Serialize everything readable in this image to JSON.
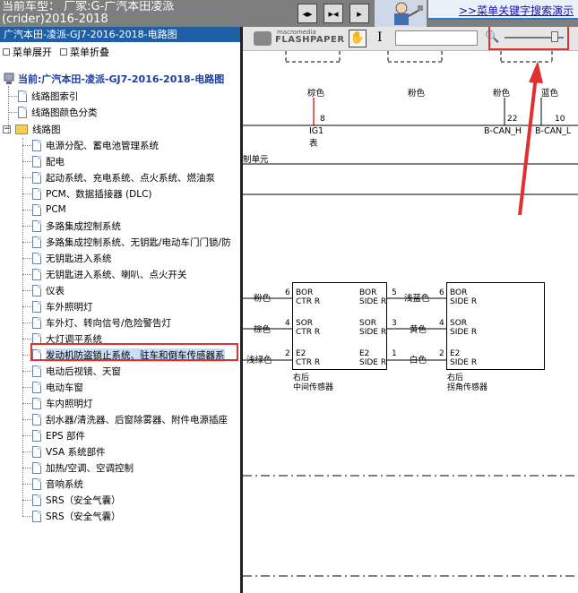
{
  "topbar": {
    "car_title": "当前车型：  厂家:G-广汽本田凌派(crider)2016-2018",
    "btn_fit": "◂▸",
    "btn_expand": "▸◂",
    "btn_more": "▸",
    "search_link": ">>菜单关键字搜索演示"
  },
  "left_panel": {
    "header": "广汽本田-凌派-GJ7-2016-2018-电路图",
    "expand_label": "菜单展开",
    "collapse_label": "菜单折叠",
    "root_label": "当前:广汽本田-凌派-GJ7-2016-2018-电路图",
    "top_items": [
      "线路图索引",
      "线路图颜色分类"
    ],
    "folder_label": "线路图",
    "items": [
      "电源分配、蓄电池管理系统",
      "配电",
      "起动系统、充电系统、点火系统、燃油泵",
      "PCM、数据插接器 (DLC)",
      "PCM",
      "多路集成控制系统",
      "多路集成控制系统、无钥匙/电动车门门锁/防",
      "无钥匙进入系统",
      "无钥匙进入系统、喇叭、点火开关",
      "仪表",
      "车外照明灯",
      "车外灯、转向信号/危险警告灯",
      "大灯调平系统",
      "发动机防盗锁止系统、驻车和倒车传感器系",
      "电动后视镜、天窗",
      "电动车窗",
      "车内照明灯",
      "刮水器/清洗器、后窗除雾器、附件电源插座",
      "EPS 部件",
      "VSA 系统部件",
      "加热/空调、空调控制",
      "音响系统",
      "SRS（安全气囊）",
      "SRS（安全气囊）"
    ],
    "selected_index": 13
  },
  "viewer": {
    "logo_small": "macromedia",
    "logo": "FLASHPAPER",
    "hand": "✋",
    "ibeam": "I",
    "zoom_icon": "🔍",
    "zoom_level": 0.85
  },
  "diagram": {
    "top_wires": [
      {
        "color": "棕色",
        "pin": "8",
        "name": "IG1",
        "sub": "表"
      },
      {
        "color": "粉色"
      },
      {
        "color": "粉色",
        "pin": "22",
        "name": "B-CAN_H"
      },
      {
        "color": "蓝色",
        "pin": "10",
        "name": "B-CAN_L"
      }
    ],
    "unit_fragment": "制单元",
    "left_wires": [
      {
        "color": "粉色",
        "pin": "6"
      },
      {
        "color": "棕色",
        "pin": "4"
      },
      {
        "color": "浅绿色",
        "pin": "2"
      }
    ],
    "center_sensor": {
      "terms_left": [
        [
          "BOR",
          "CTR R"
        ],
        [
          "SOR",
          "CTR R"
        ],
        [
          "E2",
          "CTR R"
        ]
      ],
      "terms_right": [
        [
          "BOR",
          "SIDE R"
        ],
        [
          "SOR",
          "SIDE R"
        ],
        [
          "E2",
          "SIDE R"
        ]
      ],
      "name": [
        "右后",
        "中间传感器"
      ]
    },
    "mid_wires": [
      {
        "pin_left": "5",
        "color": "浅蓝色",
        "pin_right": "6"
      },
      {
        "pin_left": "3",
        "color": "黄色",
        "pin_right": "4"
      },
      {
        "pin_left": "1",
        "color": "白色",
        "pin_right": "2"
      }
    ],
    "corner_sensor": {
      "terms": [
        [
          "BOR",
          "SIDE R"
        ],
        [
          "SOR",
          "SIDE R"
        ],
        [
          "E2",
          "SIDE R"
        ]
      ],
      "name": [
        "右后",
        "拐角传感器"
      ]
    }
  },
  "colors": {
    "header_blue": "#1e5fa8",
    "highlight_red": "#e0312f",
    "wire_red": "#e0312f",
    "topbar_gray": "#7e7e7e"
  }
}
